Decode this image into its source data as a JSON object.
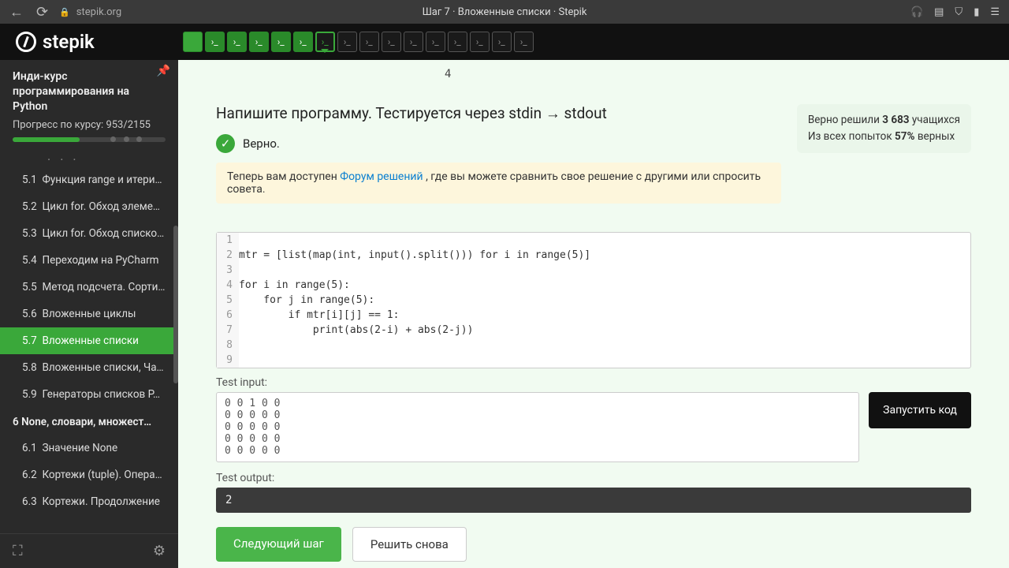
{
  "browser": {
    "url_host": "stepik.org",
    "tab_title": "Шаг 7 · Вложенные списки · Stepik"
  },
  "logo_text": "stepik",
  "sidebar": {
    "course_title": "Инди-курс программирования на Python",
    "progress_label": "Прогресс по курсу:",
    "progress_value": "953/2155",
    "section6": "6  None, словари, множест…",
    "lessons": [
      {
        "num": "5.1",
        "title": "Функция range и итери…"
      },
      {
        "num": "5.2",
        "title": "Цикл for. Обход элемен…"
      },
      {
        "num": "5.3",
        "title": "Цикл for. Обход списко…"
      },
      {
        "num": "5.4",
        "title": "Переходим на PyCharm"
      },
      {
        "num": "5.5",
        "title": "Метод подсчета. Сорти…"
      },
      {
        "num": "5.6",
        "title": "Вложенные циклы"
      },
      {
        "num": "5.7",
        "title": "Вложенные списки"
      },
      {
        "num": "5.8",
        "title": "Вложенные списки, Ча…"
      },
      {
        "num": "5.9",
        "title": "Генераторы списков P…"
      }
    ],
    "lessons6": [
      {
        "num": "6.1",
        "title": "Значение None"
      },
      {
        "num": "6.2",
        "title": "Кортежи (tuple). Опера…"
      },
      {
        "num": "6.3",
        "title": "Кортежи. Продолжение"
      }
    ]
  },
  "tiny_num": "4",
  "task": {
    "title": "Напишите программу. Тестируется через stdin → stdout",
    "verdict": "Верно.",
    "forum_prefix": "Теперь вам доступен ",
    "forum_link": "Форум решений",
    "forum_suffix": " , где вы можете сравнить свое решение с другими или спросить совета."
  },
  "stats": {
    "line1_a": "Верно решили ",
    "line1_b": "3 683",
    "line1_c": " учащихся",
    "line2_a": "Из всех попыток ",
    "line2_b": "57%",
    "line2_c": " верных"
  },
  "code_lines": [
    "",
    "mtr = [list(map(int, input().split())) for i in range(5)]",
    "",
    "for i in range(5):",
    "    for j in range(5):",
    "        if mtr[i][j] == 1:",
    "            print(abs(2-i) + abs(2-j))",
    "",
    ""
  ],
  "test": {
    "input_label": "Test input:",
    "input_value": "0 0 1 0 0\n0 0 0 0 0\n0 0 0 0 0\n0 0 0 0 0\n0 0 0 0 0",
    "output_label": "Test output:",
    "output_value": "2",
    "run_label": "Запустить код"
  },
  "buttons": {
    "next": "Следующий шаг",
    "again": "Решить снова"
  }
}
